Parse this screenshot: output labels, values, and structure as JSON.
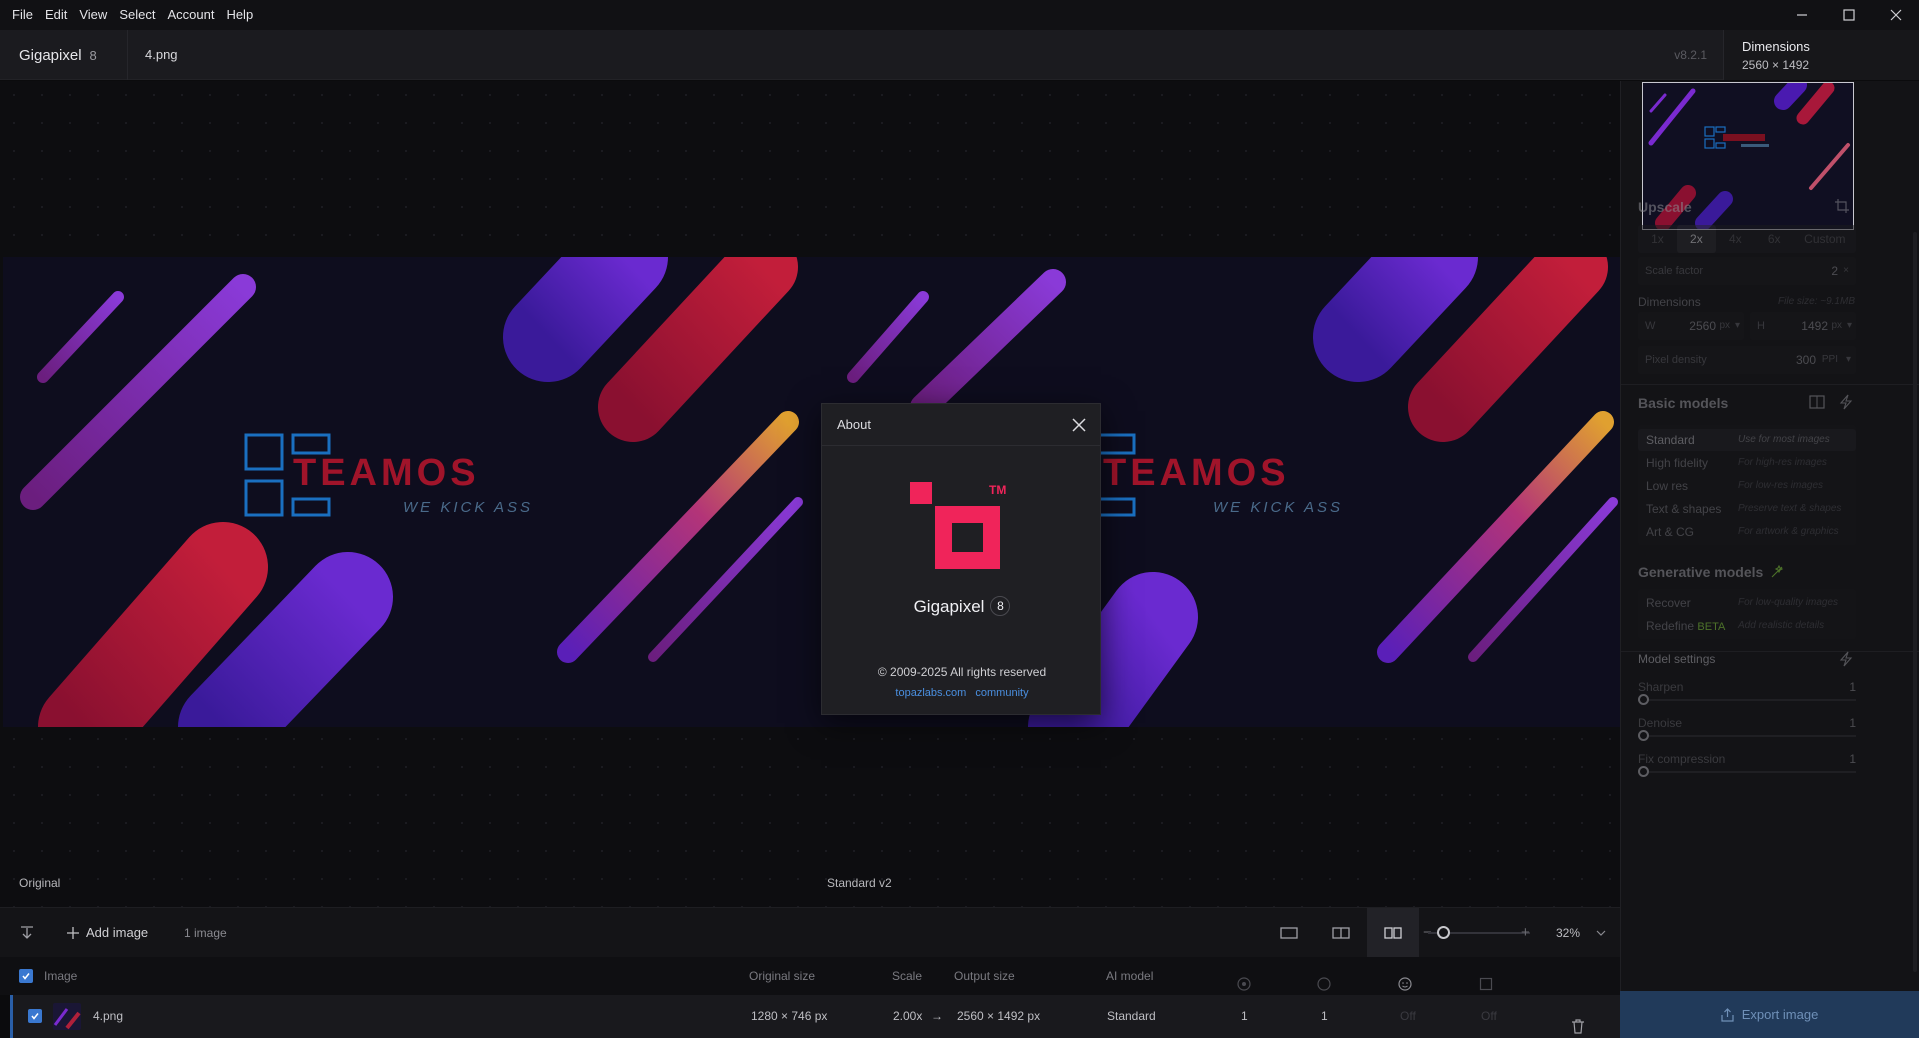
{
  "menu": [
    "File",
    "Edit",
    "View",
    "Select",
    "Account",
    "Help"
  ],
  "header": {
    "brand": "Gigapixel",
    "brand_version": "8",
    "filename": "4.png",
    "app_version": "v8.2.1",
    "dimensions_label": "Dimensions",
    "dimensions_value": "2560 × 1492"
  },
  "canvas": {
    "left_label": "Original",
    "right_label": "Standard v2",
    "preview_text": "TEAMOS",
    "preview_subtext": "WE KICK ASS"
  },
  "bottombar": {
    "add_image": "Add image",
    "image_count": "1 image",
    "zoom": "32%"
  },
  "table": {
    "headers": {
      "image": "Image",
      "original_size": "Original size",
      "scale": "Scale",
      "output_size": "Output size",
      "ai_model": "AI model"
    },
    "row": {
      "name": "4.png",
      "original_size": "1280 × 746 px",
      "scale": "2.00x",
      "output_size": "2560 × 1492 px",
      "ai_model": "Standard",
      "col1": "1",
      "col2": "1",
      "col3": "Off",
      "col4": "Off"
    }
  },
  "panel": {
    "upscale": "Upscale",
    "scale_options": [
      "1x",
      "2x",
      "4x",
      "6x",
      "Custom"
    ],
    "scale_factor_label": "Scale factor",
    "scale_factor_value": "2",
    "scale_factor_unit": "×",
    "dimensions": "Dimensions",
    "file_size": "File size: ~9.1MB",
    "w_label": "W",
    "w_value": "2560",
    "h_label": "H",
    "h_value": "1492",
    "px_unit": "px",
    "pixel_density_label": "Pixel density",
    "pixel_density_value": "300",
    "ppi_unit": "PPI",
    "basic_models": "Basic models",
    "models": [
      {
        "name": "Standard",
        "desc": "Use for most images"
      },
      {
        "name": "High fidelity",
        "desc": "For high-res images"
      },
      {
        "name": "Low res",
        "desc": "For low-res images"
      },
      {
        "name": "Text & shapes",
        "desc": "Preserve text & shapes"
      },
      {
        "name": "Art & CG",
        "desc": "For artwork & graphics"
      }
    ],
    "generative_models": "Generative models",
    "gen_models": [
      {
        "name": "Recover",
        "desc": "For low-quality images"
      },
      {
        "name": "Redefine",
        "badge": "BETA",
        "desc": "Add realistic details"
      }
    ],
    "model_settings": "Model settings",
    "sliders": [
      {
        "label": "Sharpen",
        "value": "1"
      },
      {
        "label": "Denoise",
        "value": "1"
      },
      {
        "label": "Fix compression",
        "value": "1"
      }
    ],
    "export": "Export image"
  },
  "about": {
    "title": "About",
    "app_name": "Gigapixel",
    "version_badge": "8",
    "tm": "TM",
    "copyright": "© 2009-2025 All rights reserved",
    "link1": "topazlabs.com",
    "link2": "community"
  },
  "colors": {
    "brand_pink": "#f0245a",
    "accent_blue": "#3a78d0",
    "export_bg": "#213a5a",
    "beta_green": "#7bbf3a"
  }
}
